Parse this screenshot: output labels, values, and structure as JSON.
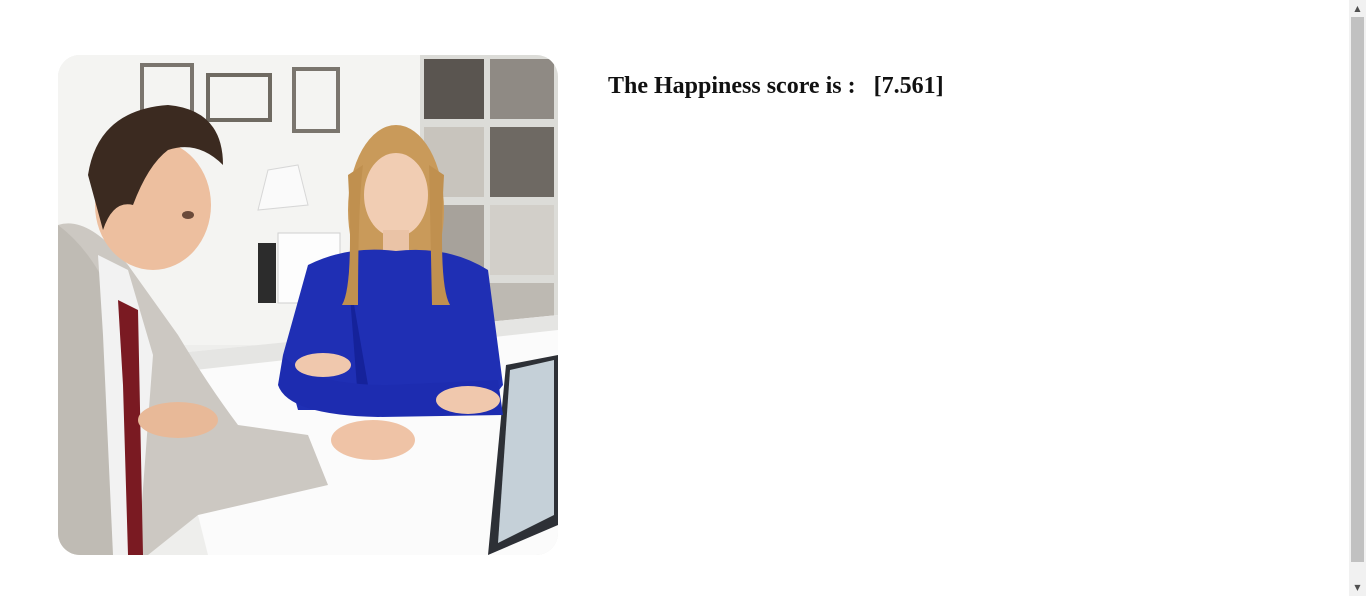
{
  "result": {
    "label": "The Happiness score is :",
    "value": "[7.561]"
  },
  "image": {
    "subject": "two-people-office-meeting-photo"
  },
  "scrollbar": {
    "up_arrow": "▲",
    "down_arrow": "▼"
  }
}
